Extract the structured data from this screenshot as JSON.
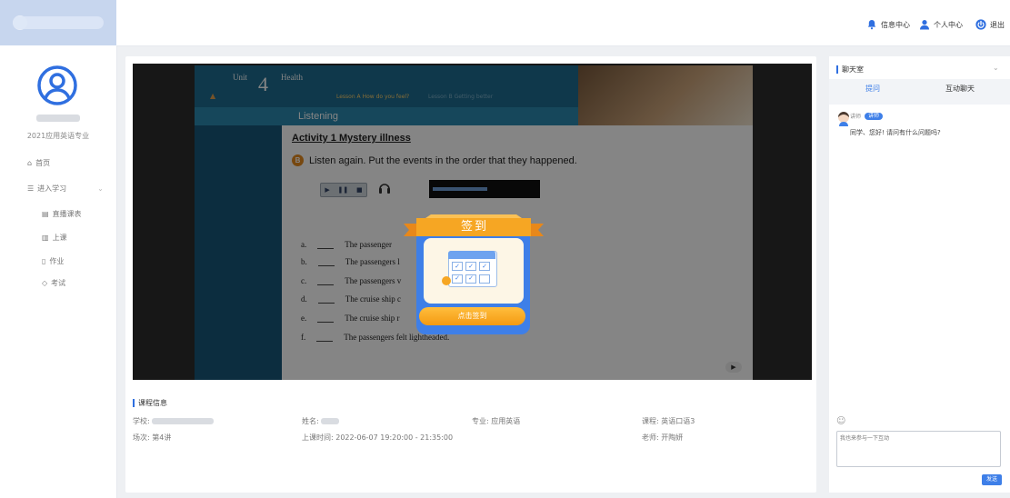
{
  "header": {
    "message_center": "信息中心",
    "profile": "个人中心",
    "logout": "退出"
  },
  "sidebar": {
    "major": "2021应用英语专业",
    "home": "首页",
    "study": "进入学习",
    "items": [
      "直播课表",
      "上课",
      "作业",
      "考试"
    ]
  },
  "slide": {
    "unit_word": "Unit",
    "unit_num": "4",
    "topic": "Health",
    "lesson_a": "Lesson A  How do you feel?",
    "lesson_b": "Lesson B  Getting better",
    "section": "Listening",
    "activity": "Activity 1  Mystery illness",
    "instr_num": "B",
    "instruction": "Listen again. Put the events in the order that they happened.",
    "options": [
      {
        "letter": "a.",
        "text": "The passenger"
      },
      {
        "letter": "b.",
        "text": "The passengers l"
      },
      {
        "letter": "c.",
        "text": "The passengers v"
      },
      {
        "letter": "d.",
        "text": "The cruise ship c"
      },
      {
        "letter": "e.",
        "text": "The cruise ship r"
      },
      {
        "letter": "f.",
        "text": "The passengers felt lightheaded."
      }
    ]
  },
  "checkin": {
    "title": "签到",
    "button": "点击签到"
  },
  "course": {
    "section_title": "课程信息",
    "school_label": "学校:",
    "name_label": "姓名:",
    "major_label": "专业: 应用英语",
    "course_label": "课程: 英语口语3",
    "session_label": "场次: 第4讲",
    "time_label": "上课时间: 2022-06-07 19:20:00 - 21:35:00",
    "teacher_label": "老师: 开陶妍"
  },
  "chat": {
    "title": "聊天室",
    "tab_ask": "提问",
    "tab_interact": "互动聊天",
    "sender": "讲师",
    "badge": "讲师",
    "message": "同学、您好! 请问有什么问题吗?",
    "input_placeholder": "我也来参与一下互动",
    "send": "发送"
  },
  "colors": {
    "accent": "#3e7fe8",
    "checkin_orange": "#f49a12"
  }
}
